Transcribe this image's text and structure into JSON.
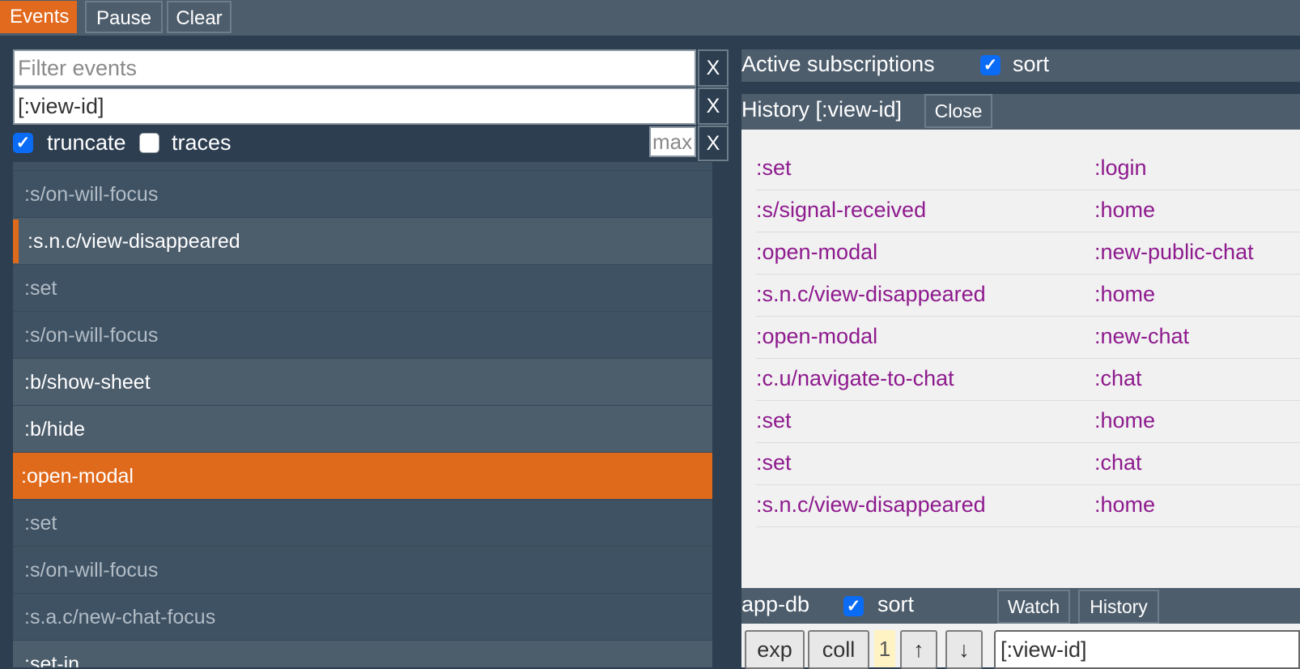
{
  "toolbar": {
    "events_tab": "Events",
    "pause": "Pause",
    "clear": "Clear"
  },
  "filters": {
    "filter_placeholder": "Filter events",
    "filter_value": "",
    "query_value": "[:view-id]",
    "clear_label": "X",
    "truncate_label": "truncate",
    "truncate_checked": true,
    "traces_label": "traces",
    "traces_checked": false,
    "max_placeholder": "max",
    "check_glyph": "✓"
  },
  "events": [
    {
      "label": ":s/on-will-focus",
      "style": "dim"
    },
    {
      "label": ":s.n.c/view-disappeared",
      "style": "bright",
      "marked": true
    },
    {
      "label": ":set",
      "style": "dim"
    },
    {
      "label": ":s/on-will-focus",
      "style": "dim"
    },
    {
      "label": ":b/show-sheet",
      "style": "bright"
    },
    {
      "label": ":b/hide",
      "style": "bright"
    },
    {
      "label": ":open-modal",
      "style": "selected"
    },
    {
      "label": ":set",
      "style": "dim"
    },
    {
      "label": ":s/on-will-focus",
      "style": "dim"
    },
    {
      "label": ":s.a.c/new-chat-focus",
      "style": "dim"
    },
    {
      "label": ":set-in",
      "style": "bright"
    }
  ],
  "subscriptions": {
    "title": "Active subscriptions",
    "sort_label": "sort",
    "sort_checked": true
  },
  "history": {
    "title": "History [:view-id]",
    "close_label": "Close",
    "rows": [
      {
        "event": ":set",
        "value": ":login"
      },
      {
        "event": ":s/signal-received",
        "value": ":home"
      },
      {
        "event": ":open-modal",
        "value": ":new-public-chat"
      },
      {
        "event": ":s.n.c/view-disappeared",
        "value": ":home"
      },
      {
        "event": ":open-modal",
        "value": ":new-chat"
      },
      {
        "event": ":c.u/navigate-to-chat",
        "value": ":chat"
      },
      {
        "event": ":set",
        "value": ":home"
      },
      {
        "event": ":set",
        "value": ":chat"
      },
      {
        "event": ":s.n.c/view-disappeared",
        "value": ":home"
      }
    ]
  },
  "app_db": {
    "title": "app-db",
    "sort_label": "sort",
    "sort_checked": true,
    "watch_label": "Watch",
    "history_label": "History",
    "exp_label": "exp",
    "coll_label": "coll",
    "count": "1",
    "up_label": "↑",
    "down_label": "↓",
    "path_value": "[:view-id]"
  },
  "colors": {
    "accent": "#e26a1f",
    "background": "#2c3e50",
    "toolbar": "#4d5d6c",
    "history_text": "#8e1a8e",
    "checkbox": "#0a6cf5"
  }
}
